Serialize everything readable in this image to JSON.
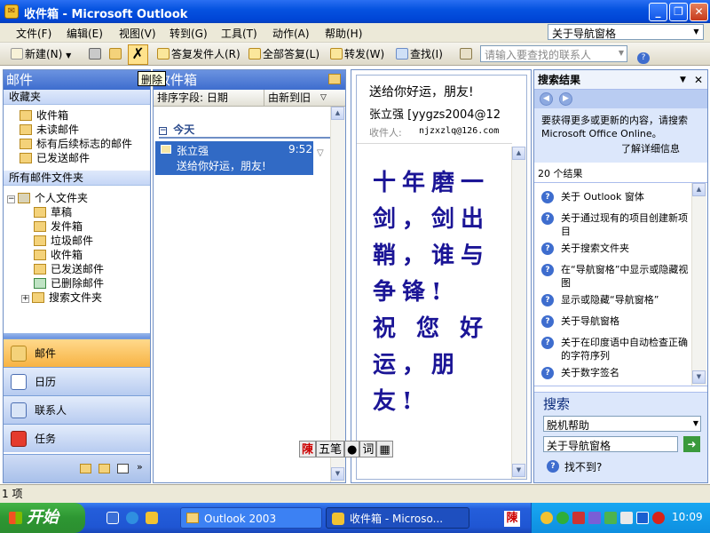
{
  "window": {
    "title": "收件箱 - Microsoft Outlook",
    "controls": [
      "_",
      "❐",
      "✕"
    ]
  },
  "menubar": {
    "items": [
      "文件(F)",
      "编辑(E)",
      "视图(V)",
      "转到(G)",
      "工具(T)",
      "动作(A)",
      "帮助(H)"
    ],
    "help_box_value": "关于导航窗格"
  },
  "toolbar": {
    "new": "新建(N)",
    "delete_tooltip": "删除",
    "reply": "答复发件人(R)",
    "reply_all": "全部答复(L)",
    "forward": "转发(W)",
    "find": "查找(I)",
    "contact_search_placeholder": "请输入要查找的联系人"
  },
  "nav_pane": {
    "header": "邮件",
    "favorites_header": "收藏夹",
    "favorites": [
      "收件箱",
      "未读邮件",
      "标有后续标志的邮件",
      "已发送邮件"
    ],
    "all_folders_header": "所有邮件文件夹",
    "root": "个人文件夹",
    "folders": [
      "草稿",
      "发件箱",
      "垃圾邮件",
      "收件箱",
      "已发送邮件",
      "已删除邮件",
      "搜索文件夹"
    ],
    "buttons": [
      "邮件",
      "日历",
      "联系人",
      "任务"
    ]
  },
  "mail_list": {
    "header": "收件箱",
    "sort_field": "排序字段: 日期",
    "sort_order": "由新到旧",
    "group": "今天",
    "items": [
      {
        "sender": "张立强",
        "time": "9:52",
        "subject": "送给你好运，朋友!"
      }
    ]
  },
  "reading_pane": {
    "subject": "送给你好运，朋友!",
    "from": "张立强 [yygzs2004@12",
    "to_label": "收件人:",
    "to": "njzxzlq@126.com",
    "body_lines": [
      "十年磨一",
      "剑，剑出",
      "鞘，谁与",
      "争锋!",
      "祝 您 好",
      "运，朋",
      "友!"
    ]
  },
  "task_pane": {
    "title": "搜索结果",
    "info_text": "要获得更多或更新的内容，请搜索 Microsoft Office Online。",
    "learn_more": "了解详细信息",
    "result_count": "20 个结果",
    "results": [
      "关于 Outlook 窗体",
      "关于通过现有的项目创建新项目",
      "关于搜索文件夹",
      "在“导航窗格”中显示或隐藏视图",
      "显示或隐藏“导航窗格”",
      "关于导航窗格",
      "关于在印度语中自动检查正确的字符序列",
      "关于数字签名"
    ],
    "search_header": "搜索",
    "search_scope": "脱机帮助",
    "search_value": "关于导航窗格",
    "cant_find": "找不到?"
  },
  "status_bar": {
    "text": "1 项"
  },
  "ime_bar": [
    "陳",
    "五笔",
    "●",
    "词"
  ],
  "taskbar": {
    "start": "开始",
    "items": [
      "Outlook 2003",
      "收件箱 - Microso..."
    ],
    "ime_indicator": "陳",
    "clock": "10:09"
  },
  "colors": {
    "titlebar": "#0a54e3",
    "pane_header": "#5582d8",
    "selection": "#316ac5",
    "body_text": "#1b1596",
    "start_button": "#2d9632"
  }
}
